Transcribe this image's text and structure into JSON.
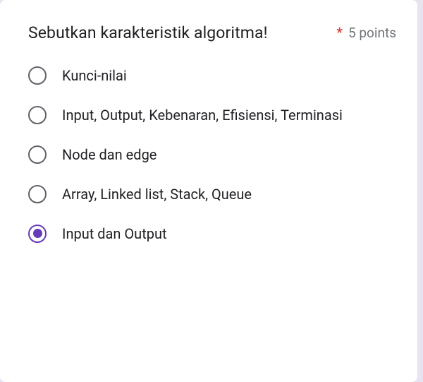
{
  "question": {
    "text": "Sebutkan karakteristik algoritma!",
    "required_mark": "*",
    "points_label": "5 points"
  },
  "options": [
    {
      "label": "Kunci-nilai",
      "selected": false
    },
    {
      "label": "Input, Output, Kebenaran, Efisiensi, Terminasi",
      "selected": false
    },
    {
      "label": "Node dan edge",
      "selected": false
    },
    {
      "label": "Array, Linked list, Stack, Queue",
      "selected": false
    },
    {
      "label": "Input dan Output",
      "selected": true
    }
  ]
}
